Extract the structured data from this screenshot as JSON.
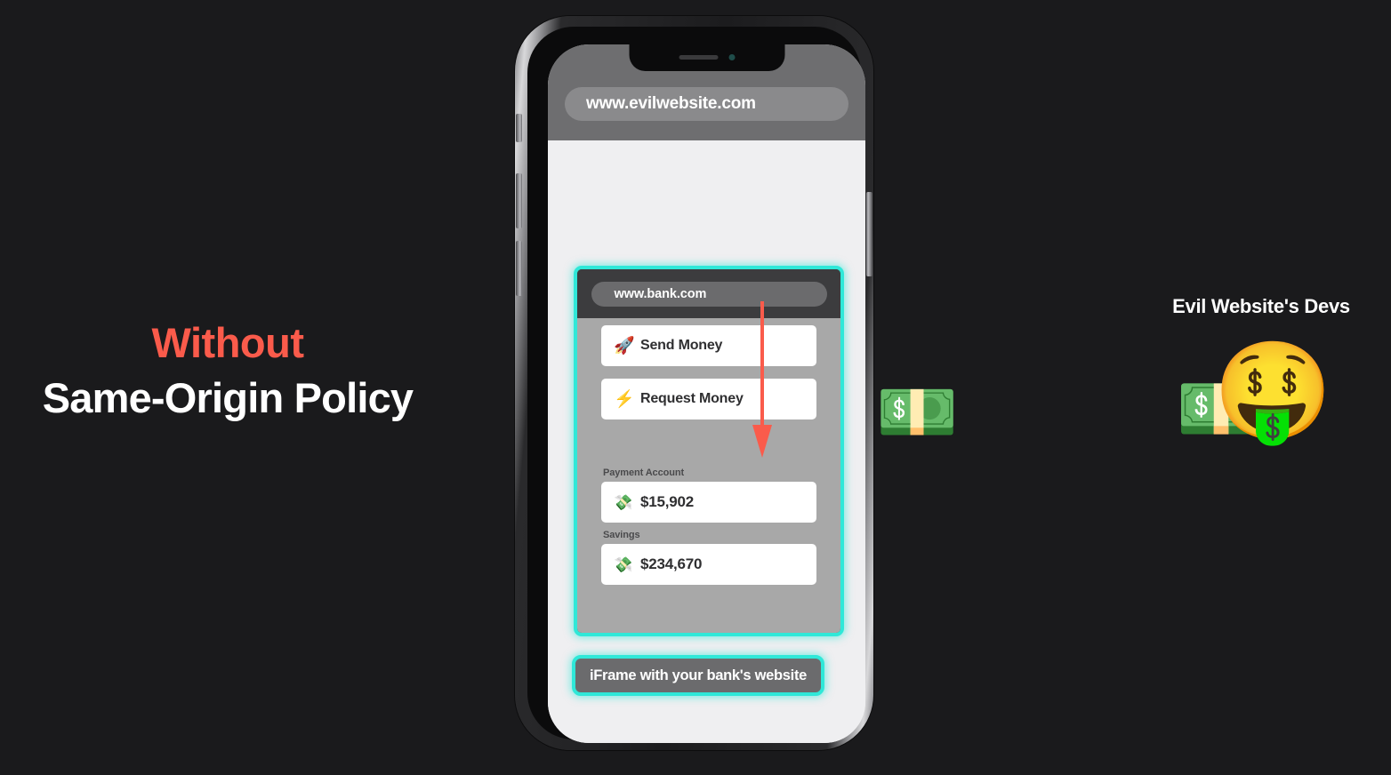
{
  "slide": {
    "background_color": "#1a1a1c",
    "headline": {
      "line1": "Without",
      "line1_color": "#fa5b4b",
      "line2": "Same-Origin Policy",
      "line2_color": "#ffffff"
    }
  },
  "phone": {
    "browser": {
      "url": "www.evilwebsite.com",
      "chrome_color": "#6e6e70",
      "page_background": "#efeff1"
    },
    "notch": {
      "speaker_icon": "speaker-slot-icon",
      "camera_icon": "front-camera-icon"
    },
    "side_buttons": [
      {
        "name": "mute-switch",
        "side": "left"
      },
      {
        "name": "volume-up-button",
        "side": "left"
      },
      {
        "name": "volume-down-button",
        "side": "left"
      },
      {
        "name": "power-button",
        "side": "right"
      }
    ]
  },
  "iframe": {
    "highlight_color": "#2fe8d8",
    "url": "www.bank.com",
    "chrome_color": "#3c3c3e",
    "content_background": "#a8a8a8",
    "actions": [
      {
        "emoji": "🚀",
        "icon_name": "rocket-icon",
        "label": "Send Money"
      },
      {
        "emoji": "⚡",
        "icon_name": "lightning-bolt-icon",
        "label": "Request Money"
      }
    ],
    "accounts": [
      {
        "label": "Payment Account",
        "emoji": "💸",
        "icon_name": "money-with-wings-icon",
        "amount": "$15,902"
      },
      {
        "label": "Savings",
        "emoji": "💸",
        "icon_name": "money-with-wings-icon",
        "amount": "$234,670"
      }
    ],
    "caption": "iFrame with your bank's website"
  },
  "annotation": {
    "arrow_color": "#fa5b4b",
    "arrow_name": "red-down-arrow",
    "points_at": "Send Money"
  },
  "money_behind_phone": {
    "emoji": "💵",
    "icon_name": "dollar-banknote-icon"
  },
  "evil_devs": {
    "title": "Evil Website's Devs",
    "face_emoji": "🤑",
    "face_icon_name": "money-mouth-face-icon",
    "banknote_emoji": "💵",
    "banknote_icon_name": "dollar-banknote-icon"
  }
}
